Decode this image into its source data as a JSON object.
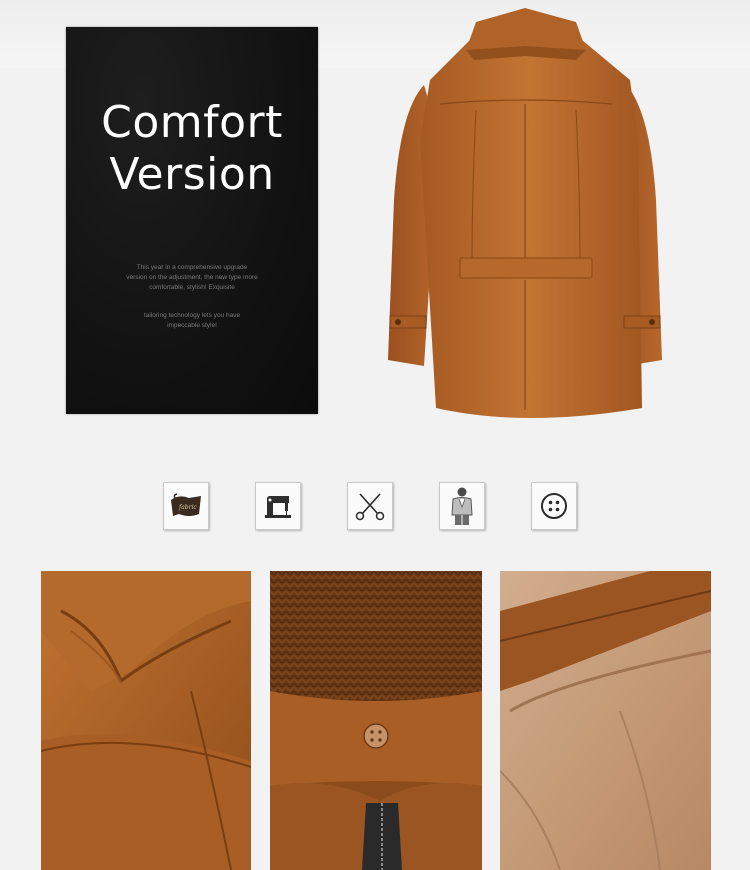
{
  "panel": {
    "headline_line1": "Comfort",
    "headline_line2": "Version",
    "desc_line1": "This year in a comprehensive upgrade",
    "desc_line2": "version on the adjustment, the new type more",
    "desc_line3": "comfortable, stylish! Exquisite",
    "desc_line4": "tailoring technology lets you have",
    "desc_line5": "impeccable style!"
  },
  "icons": [
    {
      "name": "fabric-swatch-icon",
      "label": "fabric"
    },
    {
      "name": "sewing-machine-icon"
    },
    {
      "name": "scissors-icon"
    },
    {
      "name": "model-figure-icon"
    },
    {
      "name": "button-icon"
    }
  ],
  "colors": {
    "coat": "#b8682a",
    "coat_dark": "#8a4816",
    "lining": "#c9a181",
    "panel": "#141414",
    "page": "#f2f2f2"
  }
}
